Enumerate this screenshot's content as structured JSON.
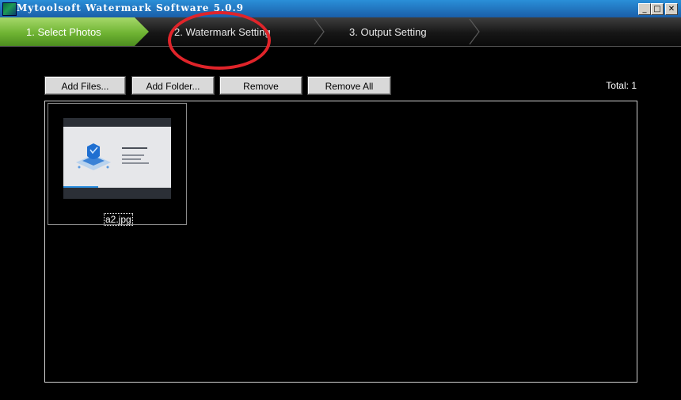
{
  "window": {
    "title": "Mytoolsoft Watermark Software 5.0.9",
    "controls": {
      "minimize": "_",
      "maximize": "□",
      "close": "✕"
    }
  },
  "steps": [
    {
      "label": "1. Select Photos",
      "active": true
    },
    {
      "label": "2. Watermark Setting",
      "active": false
    },
    {
      "label": "3. Output Setting",
      "active": false
    }
  ],
  "toolbar": {
    "add_files": "Add Files...",
    "add_folder": "Add Folder...",
    "remove": "Remove",
    "remove_all": "Remove All",
    "total": "Total: 1"
  },
  "photos": [
    {
      "filename": "a2.jpg",
      "icon": "image-thumbnail"
    }
  ],
  "colors": {
    "active_step": "#6fb433",
    "annotation": "#e0242a",
    "titlebar": "#1a5ea8"
  }
}
